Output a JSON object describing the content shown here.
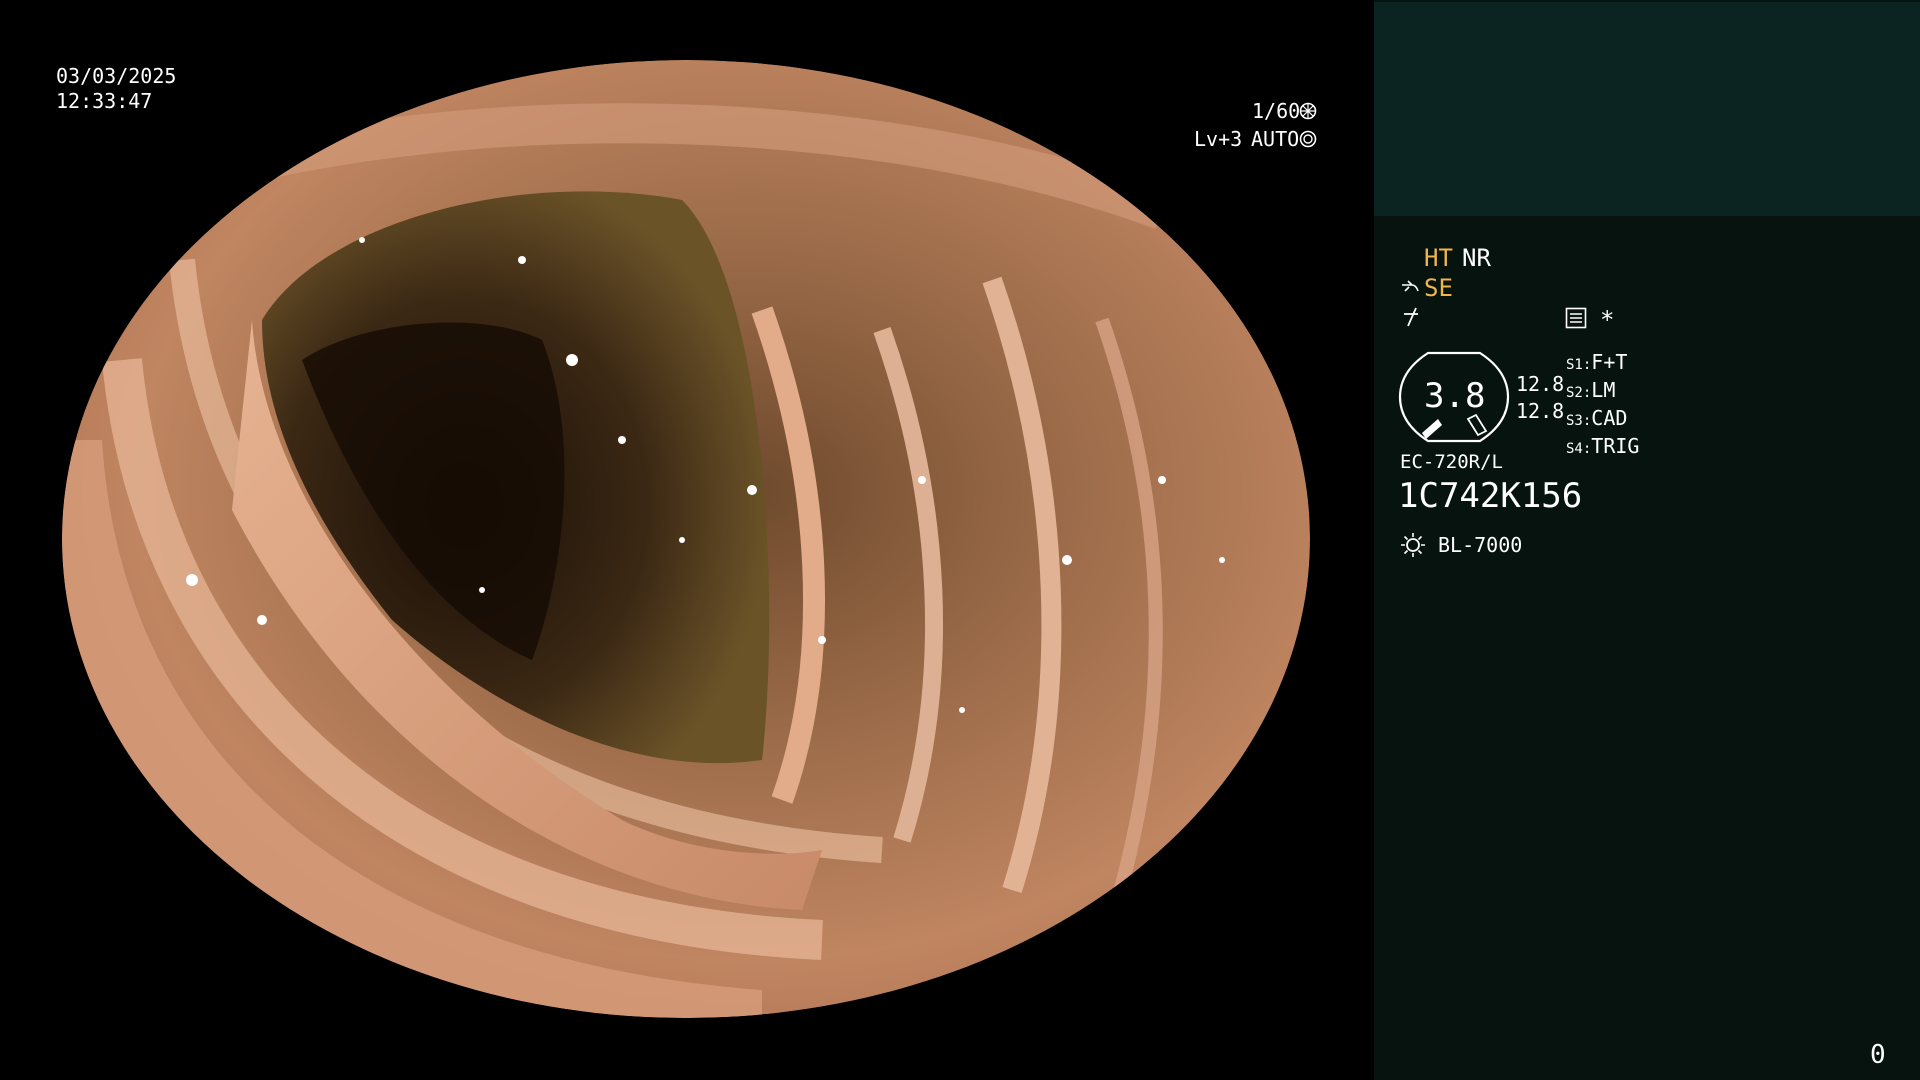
{
  "datetime": {
    "date": "03/03/2025",
    "time": "12:33:47"
  },
  "exposure": {
    "shutter": "1/60",
    "level": "Lv+3",
    "mode": "AUTO"
  },
  "status": {
    "ht": "HT",
    "nr": "NR",
    "se": "SE",
    "asterisk": "*",
    "gauge_value": "3.8",
    "readout_1": "12.8",
    "readout_2": "12.8"
  },
  "switches": [
    {
      "key": "S1",
      "value": "F+T"
    },
    {
      "key": "S2",
      "value": "LM"
    },
    {
      "key": "S3",
      "value": "CAD"
    },
    {
      "key": "S4",
      "value": "TRIG"
    }
  ],
  "scope_model": "EC-720R/L",
  "scope_serial": "1C742K156",
  "light_source": "BL-7000",
  "counter": "0",
  "colors": {
    "panel_bg": "#06130f",
    "panel_top": "#0c2421",
    "accent": "#f1b54a",
    "tissue": "#c98a66"
  },
  "icons": [
    "aperture-icon",
    "auto-iris-icon",
    "scope-bend-icon",
    "freeze-icon",
    "settings-list-icon",
    "lamp-icon",
    "gauge-icon"
  ]
}
